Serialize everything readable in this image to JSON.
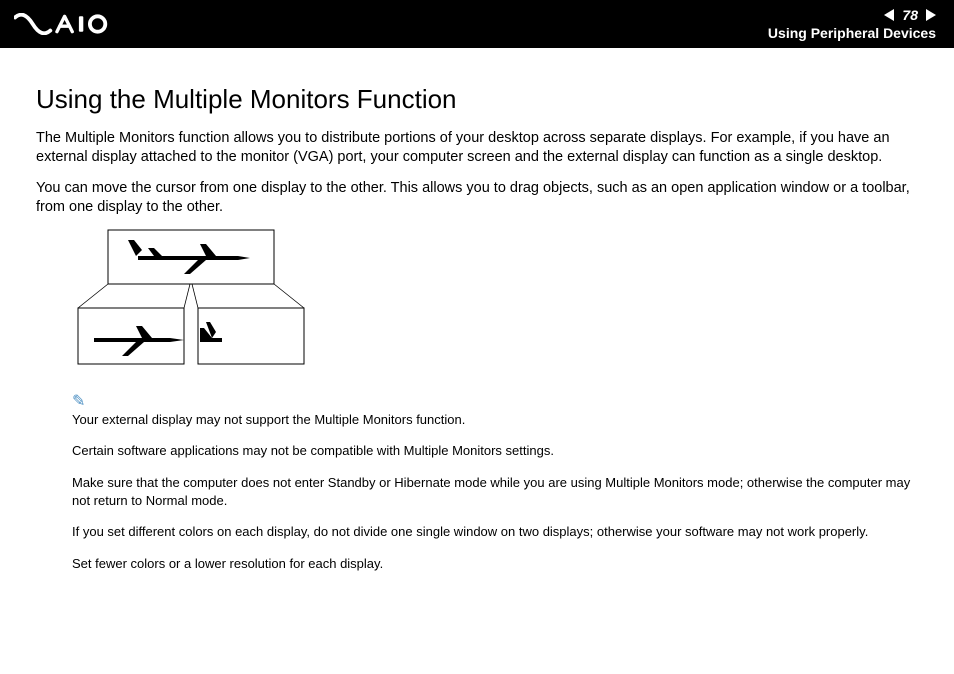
{
  "header": {
    "page_number": "78",
    "section": "Using Peripheral Devices"
  },
  "main": {
    "heading": "Using the Multiple Monitors Function",
    "para1": "The Multiple Monitors function allows you to distribute portions of your desktop across separate displays. For example, if you have an external display attached to the monitor (VGA) port, your computer screen and the external display can function as a single desktop.",
    "para2": "You can move the cursor from one display to the other. This allows you to drag objects, such as an open application window or a toolbar, from one display to the other."
  },
  "notes": [
    "Your external display may not support the Multiple Monitors function.",
    "Certain software applications may not be compatible with Multiple Monitors settings.",
    "Make sure that the computer does not enter Standby or Hibernate mode while you are using Multiple Monitors mode; otherwise the computer may not return to Normal mode.",
    "If you set different colors on each display, do not divide one single window on two displays; otherwise your software may not work properly.",
    "Set fewer colors or a lower resolution for each display."
  ]
}
